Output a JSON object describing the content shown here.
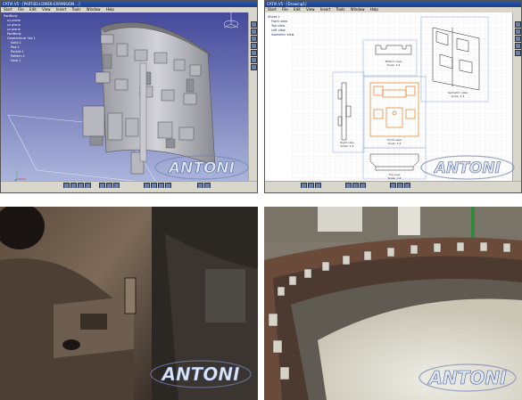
{
  "panels": {
    "catia_3d": {
      "title": "CATIA V5 - [PART-B3-LOWER-EXPANSION ...]",
      "menu": [
        "Start",
        "File",
        "Edit",
        "View",
        "Insert",
        "Tools",
        "Window",
        "Help"
      ],
      "tree_items": [
        "PartBody",
        "xy plane",
        "yz plane",
        "zx plane",
        "PartBody",
        "Geometrical Set.1",
        "Solid.1",
        "Pad.1",
        "Pocket.1",
        "Pattern.1",
        "Hole.1"
      ]
    },
    "catia_drawing": {
      "title": "CATIA V5 - [Drawing1]",
      "menu": [
        "Start",
        "File",
        "Edit",
        "View",
        "Insert",
        "Tools",
        "Window",
        "Help"
      ],
      "tree_items": [
        "Sheet.1",
        "Front view",
        "Top view",
        "Left view",
        "Isometric view"
      ],
      "views": [
        {
          "name": "Bottom view",
          "scale": "Scale: 1:4"
        },
        {
          "name": "Isometric view",
          "scale": "Scale: 1:4"
        },
        {
          "name": "Right view",
          "scale": "Scale: 1:4"
        },
        {
          "name": "Front view",
          "scale": "Scale: 1:4"
        },
        {
          "name": "Top view",
          "scale": "Scale: 1:4"
        }
      ]
    },
    "photo_closeup": {},
    "photo_ring": {}
  },
  "watermark": {
    "text": "ANTONI"
  },
  "colors": {
    "catia_bg_top": "#4b4fa0",
    "catia_bg_bottom": "#a8b2d8",
    "drawing_orange": "#e07a1a",
    "watermark_fill": "#dfe6f3",
    "watermark_stroke": "#4a5f94"
  }
}
